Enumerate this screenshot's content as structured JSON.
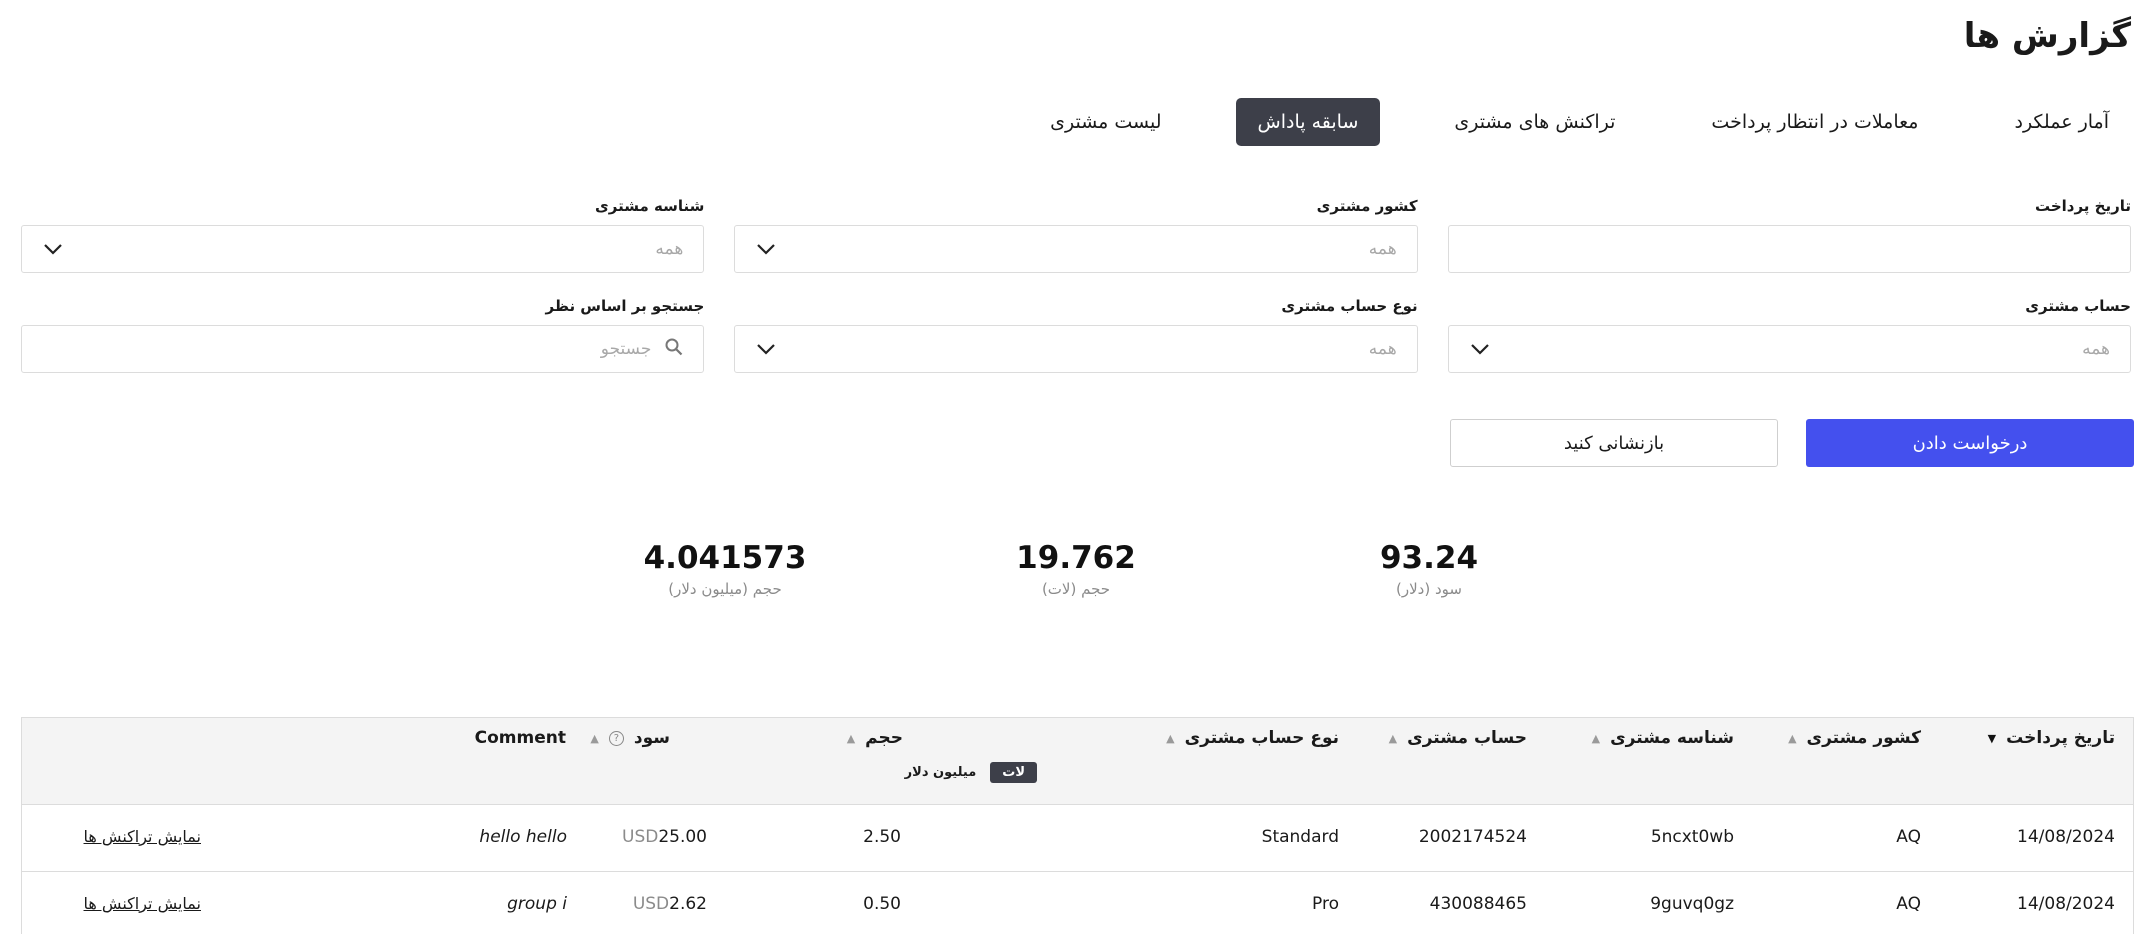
{
  "page": {
    "title": "گزارش ها"
  },
  "tabs": [
    {
      "label": "لیست مشتری",
      "active": false
    },
    {
      "label": "سابقه پاداش",
      "active": true
    },
    {
      "label": "تراکنش های مشتری",
      "active": false
    },
    {
      "label": "معاملات در انتظار پرداخت",
      "active": false
    },
    {
      "label": "آمار عملکرد",
      "active": false
    }
  ],
  "filters": {
    "payment_date": {
      "label": "تاریخ پرداخت",
      "value": ""
    },
    "client_country": {
      "label": "کشور مشتری",
      "placeholder": "همه"
    },
    "client_id": {
      "label": "شناسه مشتری",
      "placeholder": "همه"
    },
    "client_account": {
      "label": "حساب مشتری",
      "placeholder": "همه"
    },
    "account_type": {
      "label": "نوع حساب مشتری",
      "placeholder": "همه"
    },
    "comment_search": {
      "label": "جستجو بر اساس نظر",
      "placeholder": "جستجو"
    }
  },
  "actions": {
    "apply_label": "درخواست دادن",
    "reset_label": "بازنشانی کنید"
  },
  "stats": {
    "profit": {
      "value": "93.24",
      "label": "سود (دلار)"
    },
    "volume_lots": {
      "value": "19.762",
      "label": "حجم (لات)"
    },
    "volume_musd": {
      "value": "4.041573",
      "label": "حجم (میلیون دلار)"
    }
  },
  "table": {
    "headers": {
      "payment_date": "تاریخ پرداخت",
      "country": "کشور مشتری",
      "client_id": "شناسه مشتری",
      "account": "حساب مشتری",
      "account_type": "نوع حساب مشتری",
      "volume": "حجم",
      "profit": "سود",
      "comment": "Comment"
    },
    "volume_units": {
      "active": "لات",
      "alternate": "میلیون دلار"
    },
    "rows": [
      {
        "date": "14/08/2024",
        "country": "AQ",
        "client_id": "5ncxt0wb",
        "account": "2002174524",
        "account_type": "Standard",
        "volume": "2.50",
        "currency": "USD",
        "profit": "25.00",
        "comment": "hello hello",
        "link": "نمایش تراکنش ها"
      },
      {
        "date": "14/08/2024",
        "country": "AQ",
        "client_id": "9guvq0gz",
        "account": "430088465",
        "account_type": "Pro",
        "volume": "0.50",
        "currency": "USD",
        "profit": "2.62",
        "comment": "group i",
        "link": "نمایش تراکنش ها"
      }
    ]
  },
  "colors": {
    "primary": "#4450ee",
    "tab_active": "#3d3f49",
    "border": "#dcdcdc",
    "muted": "#8b8b8b"
  },
  "icons": {
    "dropdown": "chevron-down-icon",
    "search": "search-icon",
    "help": "question-circle-icon",
    "sort": "sort-triangle-icon"
  }
}
